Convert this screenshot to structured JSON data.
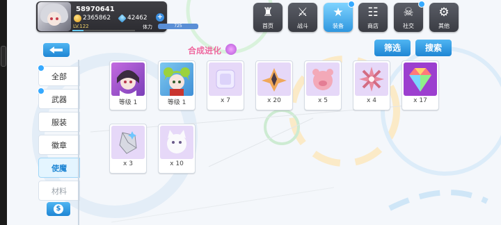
{
  "player": {
    "uid": "58970641",
    "coins": "2365862",
    "gems": "42462",
    "level": "LV.122",
    "stamina_label": "体力",
    "stamina_value": "725"
  },
  "nav": [
    {
      "label": "首页",
      "icon": "castle-icon"
    },
    {
      "label": "战斗",
      "icon": "crossed-swords-icon"
    },
    {
      "label": "装备",
      "icon": "star-icon"
    },
    {
      "label": "商店",
      "icon": "cart-icon"
    },
    {
      "label": "社交",
      "icon": "skull-icon"
    },
    {
      "label": "其他",
      "icon": "settings-icon"
    }
  ],
  "title": "合成进化",
  "actions": {
    "filter": "筛选",
    "search": "搜索"
  },
  "sidebar": [
    {
      "label": "全部"
    },
    {
      "label": "武器"
    },
    {
      "label": "服装"
    },
    {
      "label": "徽章"
    },
    {
      "label": "使魔"
    },
    {
      "label": "材料"
    }
  ],
  "items": [
    {
      "label": "等级 1",
      "icon": "dark-hair-pet-portrait"
    },
    {
      "label": "等级 1",
      "icon": "green-hair-pet-portrait"
    },
    {
      "label": "x 7",
      "icon": "crystal-cube-icon"
    },
    {
      "label": "x 20",
      "icon": "orange-shard-icon"
    },
    {
      "label": "x 5",
      "icon": "pink-pig-icon"
    },
    {
      "label": "x 4",
      "icon": "pink-flower-icon"
    },
    {
      "label": "x 17",
      "icon": "rainbow-gem-icon"
    },
    {
      "label": "x 3",
      "icon": "silver-crystal-icon"
    },
    {
      "label": "x 10",
      "icon": "white-cat-icon"
    }
  ],
  "colors": {
    "accent": "#2f97df",
    "title": "#ef6aa0",
    "item_bg": "#e6d8f8"
  }
}
